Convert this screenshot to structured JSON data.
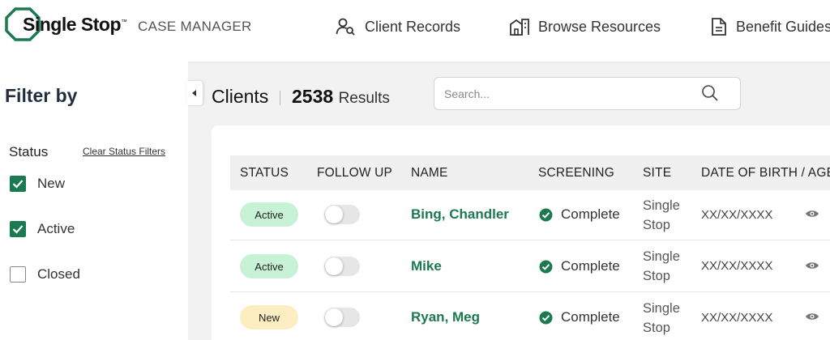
{
  "header": {
    "logo_text": "Single Stop",
    "logo_tm": "™",
    "app_name": "CASE MANAGER",
    "nav": [
      {
        "label": "Client Records",
        "icon": "user-search-icon"
      },
      {
        "label": "Browse Resources",
        "icon": "building-icon"
      },
      {
        "label": "Benefit Guides",
        "icon": "document-icon"
      }
    ]
  },
  "sidebar": {
    "title": "Filter by",
    "status_label": "Status",
    "clear_label": "Clear Status Filters",
    "filters": [
      {
        "label": "New",
        "checked": true
      },
      {
        "label": "Active",
        "checked": true
      },
      {
        "label": "Closed",
        "checked": false
      }
    ]
  },
  "main": {
    "title": "Clients",
    "result_count": "2538",
    "result_label": "Results",
    "search_placeholder": "Search...",
    "columns": [
      "STATUS",
      "FOLLOW UP",
      "NAME",
      "SCREENING",
      "SITE",
      "DATE OF BIRTH / AGE"
    ],
    "rows": [
      {
        "status": "Active",
        "status_color": "#c8f2d6",
        "follow_up": false,
        "name": "Bing, Chandler",
        "screening": "Complete",
        "site_line1": "Single",
        "site_line2": "Stop",
        "dob": "XX/XX/XXXX"
      },
      {
        "status": "Active",
        "status_color": "#c8f2d6",
        "follow_up": false,
        "name": "Mike",
        "screening": "Complete",
        "site_line1": "Single",
        "site_line2": "Stop",
        "dob": "XX/XX/XXXX"
      },
      {
        "status": "New",
        "status_color": "#fdeec2",
        "follow_up": false,
        "name": "Ryan, Meg",
        "screening": "Complete",
        "site_line1": "Single",
        "site_line2": "Stop",
        "dob": "XX/XX/XXXX"
      }
    ]
  },
  "colors": {
    "brand_green": "#1b7a4f",
    "active_badge": "#c8f2d6",
    "new_badge": "#fdeec2"
  }
}
